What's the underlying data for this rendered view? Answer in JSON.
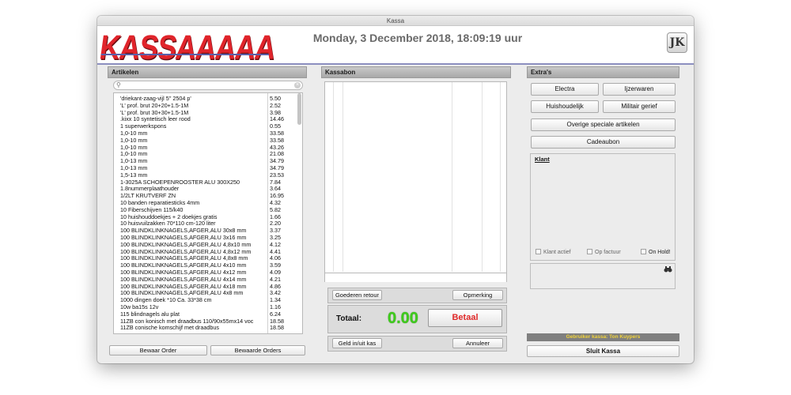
{
  "window": {
    "title": "Kassa"
  },
  "header": {
    "logo_text": "KASSAAAAA",
    "datetime": "Monday, 3 December 2018, 18:09:19 uur",
    "app_icon_glyph": "JK"
  },
  "artikelen": {
    "title": "Artikelen",
    "search": {
      "value": "",
      "placeholder": ""
    },
    "items": [
      {
        "name": "'driekant-zaag-vijl 5'' 2504 p'",
        "price": "5.50"
      },
      {
        "name": "'L' prof. brut 20+20+1.5-1M",
        "price": "2.52"
      },
      {
        "name": "'L' prof. brut 30+30+1.5-1M",
        "price": "3.98"
      },
      {
        "name": ".kixx 10 syntetisch leer rood",
        "price": "14.46"
      },
      {
        "name": "1 superwerkspons",
        "price": "0.55"
      },
      {
        "name": "1,0-10 mm",
        "price": "33.58"
      },
      {
        "name": "1,0-10 mm",
        "price": "33.58"
      },
      {
        "name": "1,0-10 mm",
        "price": "43.26"
      },
      {
        "name": "1,0-10 mm",
        "price": "21.08"
      },
      {
        "name": "1,0-13 mm",
        "price": "34.79"
      },
      {
        "name": "1,0-13 mm",
        "price": "34.79"
      },
      {
        "name": "1,5-13 mm",
        "price": "23.53"
      },
      {
        "name": "1-3025A SCHOEPENROOSTER ALU 300X250",
        "price": "7.84"
      },
      {
        "name": "1.8nummerplaathouder",
        "price": "3.64"
      },
      {
        "name": "1/2LT KRUTVERF ZN",
        "price": "16.95"
      },
      {
        "name": "10 banden reparatiesticks 4mm",
        "price": "4.32"
      },
      {
        "name": "10 Fiberschijven 115/k40",
        "price": "5.82"
      },
      {
        "name": "10 huishouddoekjes + 2 doekjes gratis",
        "price": "1.66"
      },
      {
        "name": "10 huisvuilzakken 70*110 cm-120 liter",
        "price": "2.20"
      },
      {
        "name": "100 BLINDKLINKNAGELS,AFGER,ALU 30x8 mm",
        "price": "3.37"
      },
      {
        "name": "100 BLINDKLINKNAGELS,AFGER,ALU 3x16 mm",
        "price": "3.25"
      },
      {
        "name": "100 BLINDKLINKNAGELS,AFGER,ALU 4,8x10 mm",
        "price": "4.12"
      },
      {
        "name": "100 BLINDKLINKNAGELS,AFGER,ALU 4,8x12 mm",
        "price": "4.41"
      },
      {
        "name": "100 BLINDKLINKNAGELS,AFGER,ALU 4,8x8 mm",
        "price": "4.06"
      },
      {
        "name": "100 BLINDKLINKNAGELS,AFGER,ALU 4x10 mm",
        "price": "3.59"
      },
      {
        "name": "100 BLINDKLINKNAGELS,AFGER,ALU 4x12 mm",
        "price": "4.09"
      },
      {
        "name": "100 BLINDKLINKNAGELS,AFGER,ALU 4x14 mm",
        "price": "4.21"
      },
      {
        "name": "100 BLINDKLINKNAGELS,AFGER,ALU 4x18 mm",
        "price": "4.86"
      },
      {
        "name": "100 BLINDKLINKNAGELS,AFGER,ALU 4x8 mm",
        "price": "3.42"
      },
      {
        "name": "1000 dingen doek *10 Ca. 33*38 cm",
        "price": "1.34"
      },
      {
        "name": "10w ba15s 12v",
        "price": "1.16"
      },
      {
        "name": "115 blindnagels alu plat",
        "price": "6.24"
      },
      {
        "name": "11ZB con konisch met draadbus 110/90x55mx14 voc",
        "price": "18.58"
      },
      {
        "name": "11ZB conische komschijf met draadbus",
        "price": "18.58"
      }
    ],
    "save_order_label": "Bewaar Order",
    "saved_orders_label": "Bewaarde Orders"
  },
  "kassabon": {
    "title": "Kassabon",
    "return_label": "Goederen retour",
    "remark_label": "Opmerking",
    "total_label": "Totaal:",
    "total_value": "0.00",
    "pay_label": "Betaal",
    "cash_label": "Geld in/uit kas",
    "cancel_label": "Annuleer"
  },
  "extras": {
    "title": "Extra's",
    "electra_label": "Electra",
    "ijzerwaren_label": "Ijzerwaren",
    "huishoudelijk_label": "Huishoudelijk",
    "militair_label": "Militair gerief",
    "overige_label": "Overige speciale artikelen",
    "cadeaubon_label": "Cadeaubon",
    "klant_title": "Klant",
    "klant_actief_label": "Klant actief",
    "op_factuur_label": "Op factuur",
    "on_hold_label": "On Hold!",
    "user_label": "Gebruiker kassa: Ton Kuypers",
    "close_label": "Sluit Kassa"
  },
  "colors": {
    "logo": "#e0242b",
    "total": "#3ecb1c",
    "pay": "#e02a2a",
    "user_text": "#f0d23a",
    "header_line": "#8c8fc0"
  }
}
